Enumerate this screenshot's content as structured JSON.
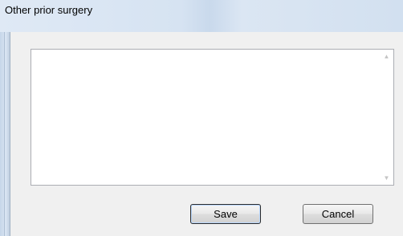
{
  "window": {
    "title": "Other prior surgery"
  },
  "text_box": {
    "value": "",
    "placeholder": ""
  },
  "scrollbar": {
    "up_icon": "▲",
    "down_icon": "▼"
  },
  "buttons": {
    "save_label": "Save",
    "cancel_label": "Cancel"
  }
}
